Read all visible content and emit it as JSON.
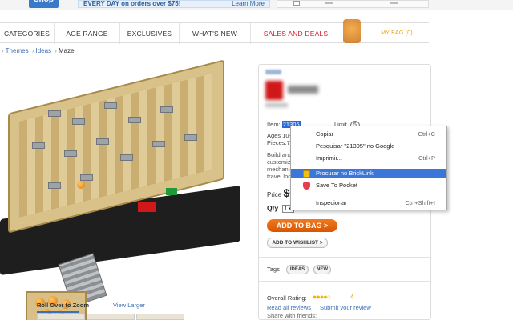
{
  "header": {
    "logo_text": "Shop",
    "promo_text": "EVERY DAY on orders over $75!",
    "promo_link": "Learn More"
  },
  "nav": {
    "items": [
      "CATEGORIES",
      "AGE RANGE",
      "EXCLUSIVES",
      "WHAT'S NEW",
      "SALES AND DEALS",
      "MY BAG (0)"
    ]
  },
  "breadcrumb": {
    "items": [
      "Themes",
      "Ideas",
      "Maze"
    ],
    "separator": "›"
  },
  "gallery": {
    "rollover_label": "Roll Over to Zoom",
    "view_larger": "View Larger"
  },
  "product": {
    "item_label": "Item:",
    "item_number": "21305",
    "limit_label": "Limit",
    "limit_value": "5",
    "ages_label": "Ages 10-",
    "pieces_label": "Pieces:",
    "pieces_value": "769",
    "desc_lines": [
      "Build and m",
      "customizab",
      "mechanism",
      "travel lock"
    ],
    "price_label": "Price",
    "price_value": "$69",
    "qty_label": "Qty",
    "qty_value": "1 ▾",
    "add_to_bag": "ADD TO BAG >",
    "add_to_wishlist": "ADD TO WISHLIST >",
    "tags_label": "Tags",
    "tags": [
      "IDEAS",
      "NEW"
    ],
    "rating_label": "Overall Rating:",
    "rating_value": "4",
    "rating_stars": 4,
    "read_reviews": "Read all reviews",
    "submit_review": "Submit your review",
    "share_label": "Share with friends:"
  },
  "context_menu": {
    "items": [
      {
        "label": "Copiar",
        "shortcut": "Ctrl+C"
      },
      {
        "label": "Pesquisar \"21305\" no Google",
        "shortcut": ""
      },
      {
        "label": "Imprimir...",
        "shortcut": "Ctrl+P"
      },
      {
        "label": "Procurar no BrickLink",
        "shortcut": "",
        "icon": "bricklink-icon",
        "highlighted": true
      },
      {
        "label": "Save To Pocket",
        "shortcut": "",
        "icon": "pocket-icon"
      },
      {
        "label": "Inspecionar",
        "shortcut": "Ctrl+Shift+I"
      }
    ]
  },
  "colors": {
    "accent_blue": "#3b6fb6",
    "sales_red": "#d0202a",
    "bag_yellow": "#e3a700",
    "add_button_orange": "#f07a20",
    "menu_highlight": "#3b76d8"
  }
}
